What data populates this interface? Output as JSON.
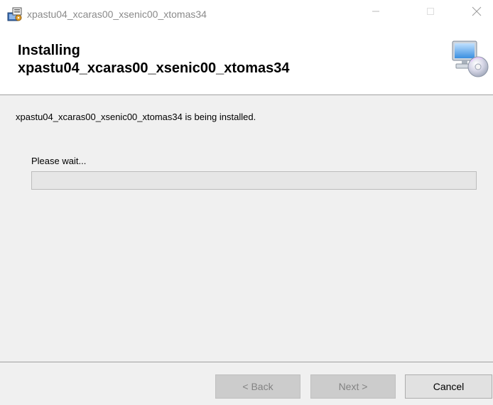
{
  "window": {
    "title": "xpastu04_xcaras00_xsenic00_xtomas34",
    "controls": {
      "minimize_icon": "minimize-icon",
      "maximize_icon": "maximize-icon",
      "close_icon": "close-icon"
    }
  },
  "banner": {
    "title_line1": "Installing",
    "title_line2": "xpastu04_xcaras00_xsenic00_xtomas34",
    "icon": "computer-cd-icon"
  },
  "content": {
    "status_text": "xpastu04_xcaras00_xsenic00_xtomas34 is being installed.",
    "wait_label": "Please wait...",
    "progress": 0
  },
  "footer": {
    "back_label": "< Back",
    "next_label": "Next >",
    "cancel_label": "Cancel"
  },
  "colors": {
    "titlebar_bg": "#ffffff",
    "body_bg": "#f0f0f0",
    "progress_bg": "#e6e6e6",
    "button_disabled_bg": "#cccccc",
    "button_bg": "#e1e1e1"
  }
}
